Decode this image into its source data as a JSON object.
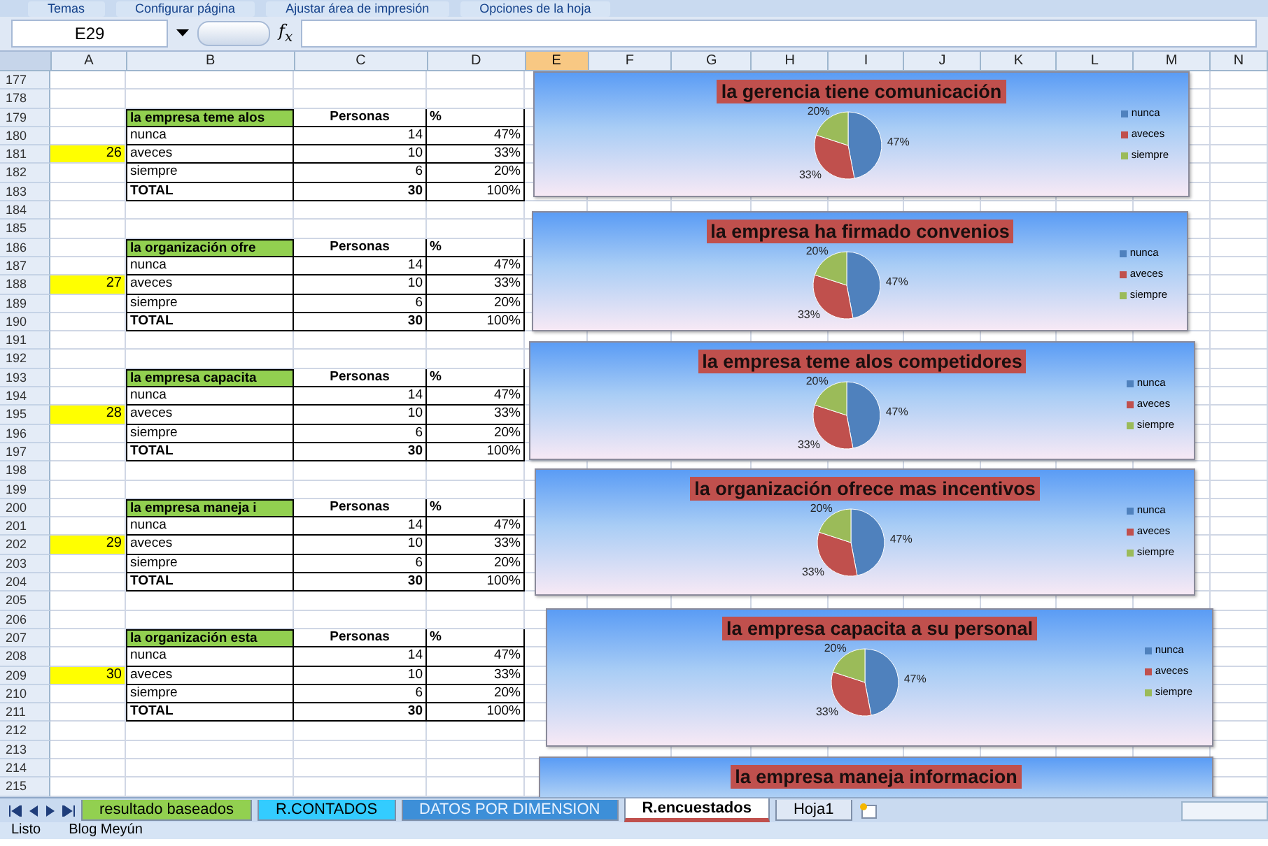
{
  "ribbon_groups": [
    "Temas",
    "Configurar página",
    "Ajustar área de impresión",
    "Opciones de la hoja"
  ],
  "formula_bar": {
    "name_box": "E29",
    "function_label": "f$_{x}$"
  },
  "columns": [
    {
      "label": "A",
      "selected": false
    },
    {
      "label": "B",
      "selected": false
    },
    {
      "label": "C",
      "selected": false
    },
    {
      "label": "D",
      "selected": false
    },
    {
      "label": "E",
      "selected": true
    },
    {
      "label": "F",
      "selected": false
    },
    {
      "label": "G",
      "selected": false
    },
    {
      "label": "H",
      "selected": false
    },
    {
      "label": "I",
      "selected": false
    },
    {
      "label": "J",
      "selected": false
    },
    {
      "label": "K",
      "selected": false
    },
    {
      "label": "L",
      "selected": false
    },
    {
      "label": "M",
      "selected": false
    },
    {
      "label": "N",
      "selected": false
    }
  ],
  "row_numbers": [
    "177",
    "178",
    "179",
    "180",
    "181",
    "182",
    "183",
    "184",
    "185",
    "186",
    "187",
    "188",
    "189",
    "190",
    "191",
    "192",
    "193",
    "194",
    "195",
    "196",
    "197",
    "198",
    "199",
    "200",
    "201",
    "202",
    "203",
    "204",
    "205",
    "206",
    "207",
    "208",
    "209",
    "210",
    "211",
    "212",
    "213",
    "214",
    "215"
  ],
  "tables": [
    {
      "marker": "26",
      "title": "la empresa teme alos",
      "count_header": "Personas",
      "pct_header": "%",
      "rows": [
        {
          "label": "nunca",
          "count": "14",
          "pct": "47%"
        },
        {
          "label": "aveces",
          "count": "10",
          "pct": "33%"
        },
        {
          "label": "siempre",
          "count": "6",
          "pct": "20%"
        }
      ],
      "total": {
        "label": "TOTAL",
        "count": "30",
        "pct": "100%"
      }
    },
    {
      "marker": "27",
      "title": "la organización ofre",
      "count_header": "Personas",
      "pct_header": "%",
      "rows": [
        {
          "label": "nunca",
          "count": "14",
          "pct": "47%"
        },
        {
          "label": "aveces",
          "count": "10",
          "pct": "33%"
        },
        {
          "label": "siempre",
          "count": "6",
          "pct": "20%"
        }
      ],
      "total": {
        "label": "TOTAL",
        "count": "30",
        "pct": "100%"
      }
    },
    {
      "marker": "28",
      "title": "la empresa capacita",
      "count_header": "Personas",
      "pct_header": "%",
      "rows": [
        {
          "label": "nunca",
          "count": "14",
          "pct": "47%"
        },
        {
          "label": "aveces",
          "count": "10",
          "pct": "33%"
        },
        {
          "label": "siempre",
          "count": "6",
          "pct": "20%"
        }
      ],
      "total": {
        "label": "TOTAL",
        "count": "30",
        "pct": "100%"
      }
    },
    {
      "marker": "29",
      "title": "la empresa maneja i",
      "count_header": "Personas",
      "pct_header": "%",
      "rows": [
        {
          "label": "nunca",
          "count": "14",
          "pct": "47%"
        },
        {
          "label": "aveces",
          "count": "10",
          "pct": "33%"
        },
        {
          "label": "siempre",
          "count": "6",
          "pct": "20%"
        }
      ],
      "total": {
        "label": "TOTAL",
        "count": "30",
        "pct": "100%"
      }
    },
    {
      "marker": "30",
      "title": "la organización esta",
      "count_header": "Personas",
      "pct_header": "%",
      "rows": [
        {
          "label": "nunca",
          "count": "14",
          "pct": "47%"
        },
        {
          "label": "aveces",
          "count": "10",
          "pct": "33%"
        },
        {
          "label": "siempre",
          "count": "6",
          "pct": "20%"
        }
      ],
      "total": {
        "label": "TOTAL",
        "count": "30",
        "pct": "100%"
      }
    }
  ],
  "charts": [
    {
      "title": "la gerencia tiene comunicación",
      "slices": [
        {
          "color": "#4f81bd"
        },
        {
          "color": "#c0504d"
        },
        {
          "color": "#9bbb59"
        }
      ],
      "chart_data": {
        "type": "pie",
        "categories": [
          "nunca",
          "aveces",
          "siempre"
        ],
        "series": [
          {
            "values": [
              47,
              33,
              20
            ]
          }
        ],
        "value_labels": [
          "47%",
          "33%",
          "20%"
        ],
        "legend": "right"
      }
    },
    {
      "title": "la empresa ha firmado convenios",
      "slices": [
        {
          "color": "#4f81bd"
        },
        {
          "color": "#c0504d"
        },
        {
          "color": "#9bbb59"
        }
      ],
      "chart_data": {
        "type": "pie",
        "categories": [
          "nunca",
          "aveces",
          "siempre"
        ],
        "series": [
          {
            "values": [
              47,
              33,
              20
            ]
          }
        ],
        "value_labels": [
          "47%",
          "33%",
          "20%"
        ],
        "legend": "right"
      }
    },
    {
      "title": "la empresa teme alos competidores",
      "slices": [
        {
          "color": "#4f81bd"
        },
        {
          "color": "#c0504d"
        },
        {
          "color": "#9bbb59"
        }
      ],
      "chart_data": {
        "type": "pie",
        "categories": [
          "nunca",
          "aveces",
          "siempre"
        ],
        "series": [
          {
            "values": [
              47,
              33,
              20
            ]
          }
        ],
        "value_labels": [
          "47%",
          "33%",
          "20%"
        ],
        "legend": "right"
      }
    },
    {
      "title": "la organización ofrece mas incentivos",
      "slices": [
        {
          "color": "#4f81bd"
        },
        {
          "color": "#c0504d"
        },
        {
          "color": "#9bbb59"
        }
      ],
      "chart_data": {
        "type": "pie",
        "categories": [
          "nunca",
          "aveces",
          "siempre"
        ],
        "series": [
          {
            "values": [
              47,
              33,
              20
            ]
          }
        ],
        "value_labels": [
          "47%",
          "33%",
          "20%"
        ],
        "legend": "right"
      }
    },
    {
      "title": "la empresa capacita a su personal",
      "slices": [
        {
          "color": "#4f81bd"
        },
        {
          "color": "#c0504d"
        },
        {
          "color": "#9bbb59"
        }
      ],
      "chart_data": {
        "type": "pie",
        "categories": [
          "nunca",
          "aveces",
          "siempre"
        ],
        "series": [
          {
            "values": [
              47,
              33,
              20
            ]
          }
        ],
        "value_labels": [
          "47%",
          "33%",
          "20%"
        ],
        "legend": "right"
      }
    },
    {
      "title": "la empresa maneja informacion"
    }
  ],
  "sheet_tabs": [
    {
      "label": "resultado baseados",
      "color": "#92d050",
      "selected": false
    },
    {
      "label": "R.CONTADOS",
      "color": "#33ccff",
      "selected": false
    },
    {
      "label": "DATOS POR DIMENSION",
      "color": "#3d8fd8",
      "selected": false
    },
    {
      "label": "R.encuestados",
      "color": "#c0504d",
      "selected": true
    },
    {
      "label": "Hoja1",
      "selected": false
    }
  ],
  "status_bar": [
    "Listo",
    "Blog Meyún"
  ]
}
